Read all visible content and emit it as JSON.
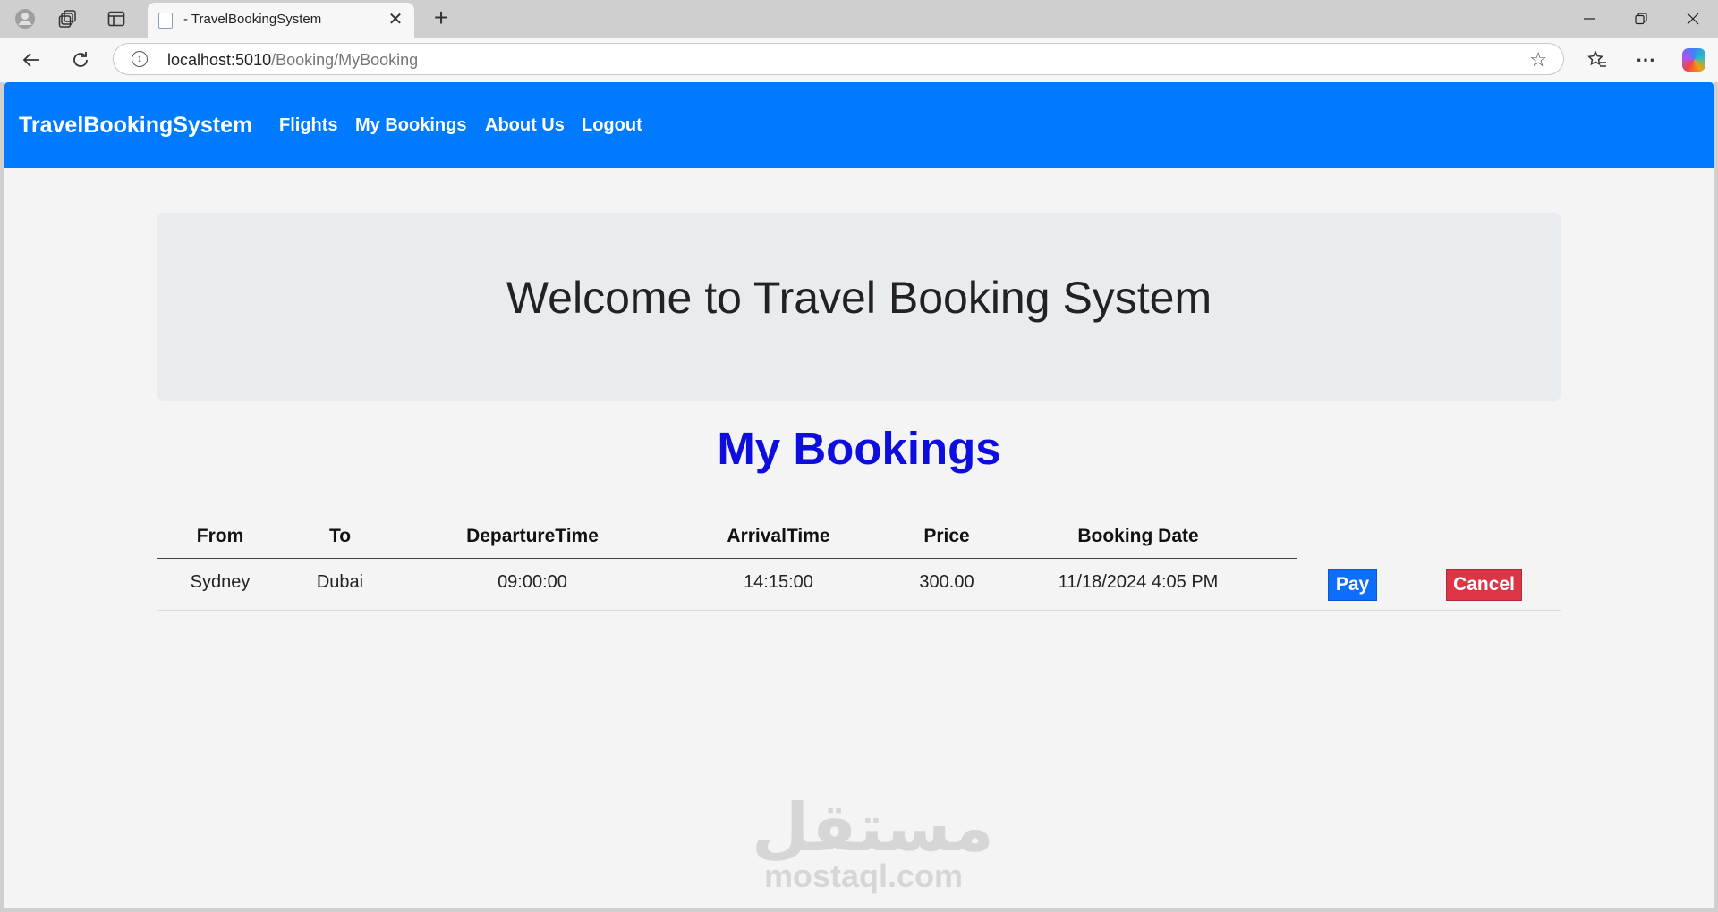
{
  "browser": {
    "tab_title": "- TravelBookingSystem",
    "url_host": "localhost:5010",
    "url_path": "/Booking/MyBooking"
  },
  "navbar": {
    "brand": "TravelBookingSystem",
    "links": [
      "Flights",
      "My Bookings",
      "About Us",
      "Logout"
    ],
    "color": "#007bff"
  },
  "jumbotron": {
    "title": "Welcome to Travel Booking System"
  },
  "section_title": "My Bookings",
  "table": {
    "headers": [
      "From",
      "To",
      "DepartureTime",
      "ArrivalTime",
      "Price",
      "Booking Date"
    ],
    "rows": [
      {
        "from": "Sydney",
        "to": "Dubai",
        "departure": "09:00:00",
        "arrival": "14:15:00",
        "price": "300.00",
        "booking_date": "11/18/2024 4:05 PM",
        "pay_label": "Pay",
        "cancel_label": "Cancel"
      }
    ]
  },
  "watermark": {
    "arabic": "مستقل",
    "latin": "mostaql.com"
  },
  "colors": {
    "pay": "#0d6efd",
    "cancel": "#dc3545",
    "section_title": "#0d0de0"
  }
}
